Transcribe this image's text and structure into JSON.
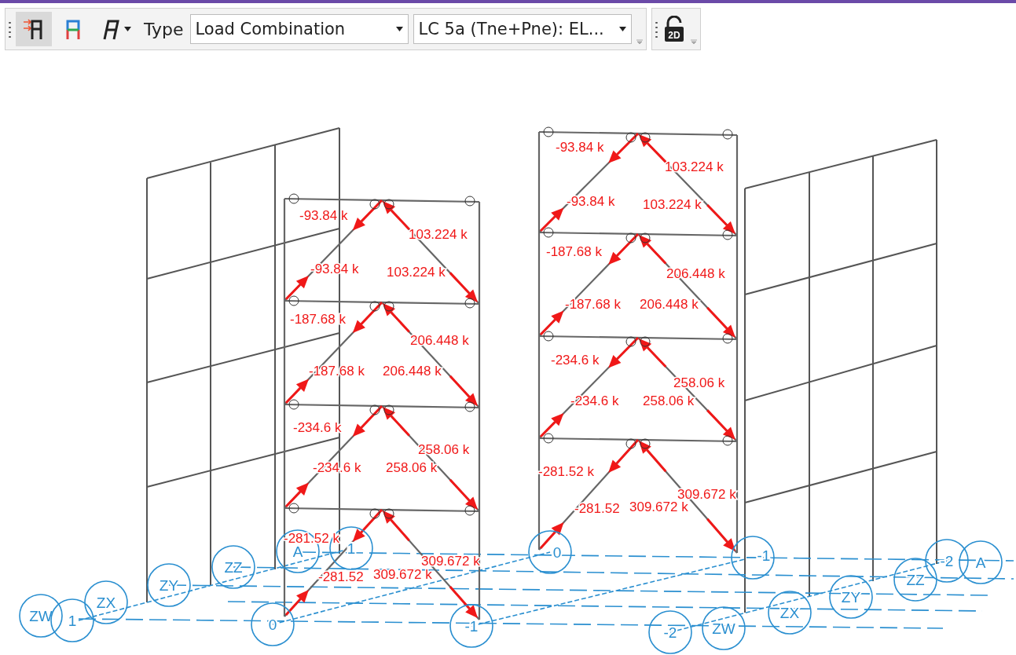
{
  "toolbar": {
    "buttons": [
      {
        "kind": "axial",
        "selected": true
      },
      {
        "kind": "colored",
        "selected": false
      },
      {
        "kind": "italic",
        "selected": false
      }
    ],
    "type_label": "Type",
    "selects": [
      {
        "value": "Load Combination"
      },
      {
        "value": "LC 5a (Tne+Pne): EL..."
      }
    ],
    "view_lock": {
      "label": "2D"
    }
  },
  "diagram": {
    "force_labels": [
      "-93.84 k",
      "103.224 k",
      "-93.84 k",
      "103.224 k",
      "-187.68 k",
      "206.448 k",
      "-187.68 k",
      "206.448 k",
      "-234.6 k",
      "258.06 k",
      "-234.6 k",
      "258.06 k",
      "-281.52 k",
      "309.672 k",
      "-281.52",
      "309.672 k",
      "-93.84 k",
      "103.224 k",
      "-93.84 k",
      "103.224 k",
      "-187.68 k",
      "206.448 k",
      "-187.68 k",
      "206.448 k",
      "-234.6 k",
      "258.06 k",
      "-234.6 k",
      "258.06 k",
      "-281.52 k",
      "309.672 k",
      "-281.52",
      "309.672 k"
    ],
    "grid_bubbles": [
      "ZW",
      "1",
      "ZX",
      "ZY",
      "ZZ",
      "A",
      "1",
      "0",
      "-1",
      "0",
      "-1",
      "-2",
      "ZW",
      "ZX",
      "ZY",
      "ZZ",
      "-2",
      "A"
    ]
  }
}
